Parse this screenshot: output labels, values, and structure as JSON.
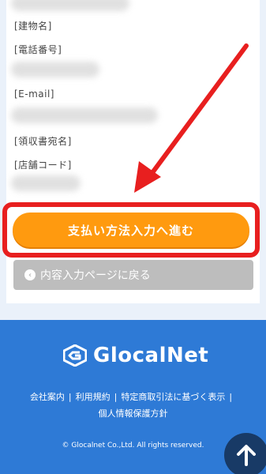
{
  "form": {
    "building_label": "[建物名]",
    "phone_label": "[電話番号]",
    "email_label": "[E-mail]",
    "receipt_label": "[領収書宛名]",
    "store_code_label": "[店舗コード]"
  },
  "buttons": {
    "proceed_label": "支払い方法入力へ進む",
    "back_label": "内容入力ページに戻る"
  },
  "footer": {
    "logo_text": "GlocalNet",
    "links": [
      "会社案内",
      "利用規約",
      "特定商取引法に基づく表示",
      "個人情報保護方針"
    ],
    "copyright": "© Glocalnet Co.,Ltd. All rights reserved."
  },
  "colors": {
    "accent": "#ff9a0f",
    "highlight": "#e81f1f",
    "footer_bg": "#2e7ad6"
  },
  "icons": {
    "back": "circle-left-arrow-icon",
    "logo": "glocalnet-logo-icon",
    "scroll_top": "up-arrow-icon",
    "annotation": "red-arrow-pointer"
  }
}
